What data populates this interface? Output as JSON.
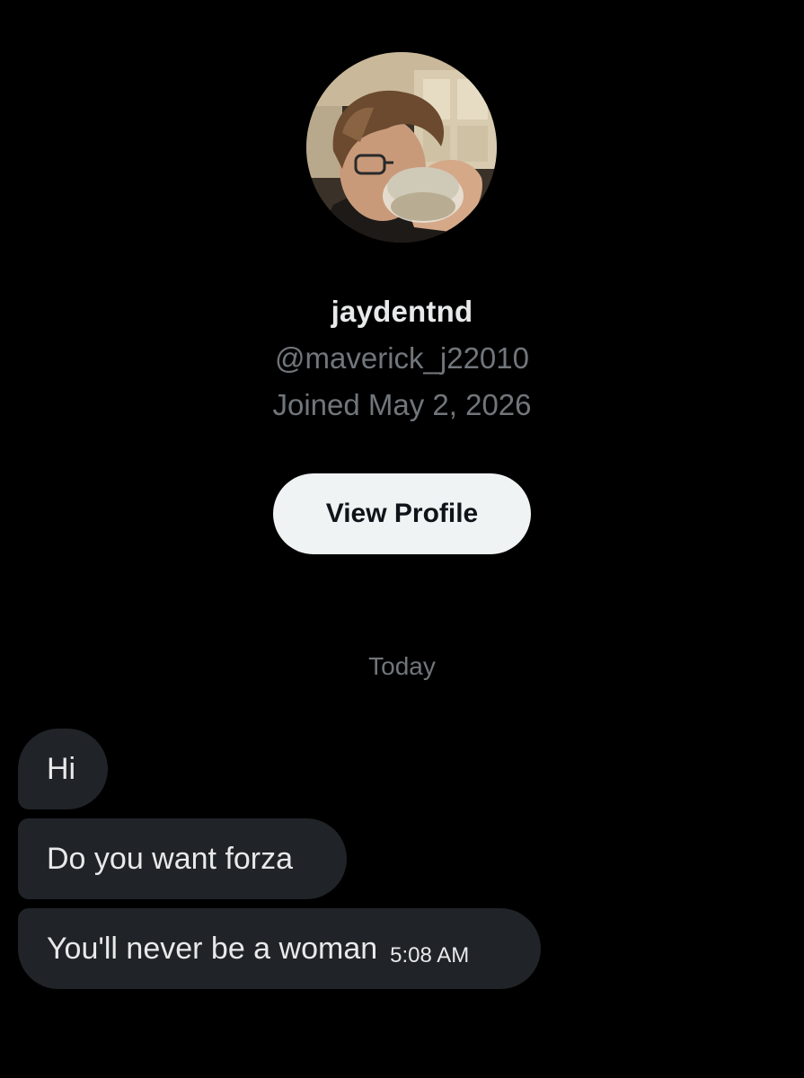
{
  "profile": {
    "display_name": "jaydentnd",
    "handle": "@maverick_j22010",
    "joined": "Joined May 2, 2026",
    "view_profile_label": "View Profile"
  },
  "conversation": {
    "date_separator": "Today",
    "messages": [
      {
        "text": "Hi"
      },
      {
        "text": "Do you want forza"
      },
      {
        "text": "You'll never be a woman",
        "time": "5:08 AM"
      }
    ]
  },
  "colors": {
    "background": "#000000",
    "primary_text": "#e7e9ea",
    "secondary_text": "#71767b",
    "bubble": "#202327",
    "button_bg": "#eff3f4",
    "button_text": "#0f1419"
  }
}
